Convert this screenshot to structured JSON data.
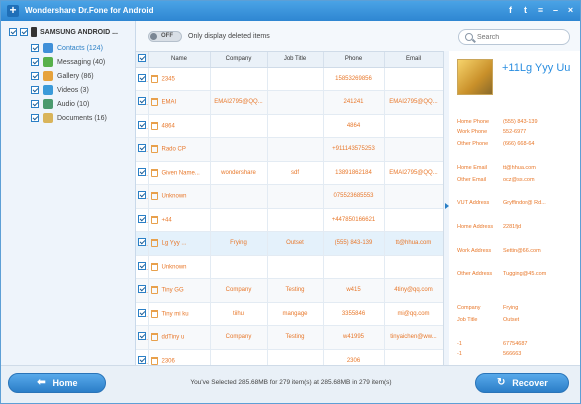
{
  "window": {
    "title": "Wondershare Dr.Fone for Android"
  },
  "titlebar_icons": [
    "facebook-icon",
    "twitter-icon",
    "menu-icon",
    "minimize-icon",
    "close-icon"
  ],
  "sidebar": {
    "device": "SAMSUNG ANDROID ...",
    "items": [
      {
        "label": "Contacts (124)",
        "icon": "contacts-icon",
        "color": "#3f8fd8",
        "active": true
      },
      {
        "label": "Messaging (40)",
        "icon": "messaging-icon",
        "color": "#57b04a",
        "active": false
      },
      {
        "label": "Gallery (86)",
        "icon": "gallery-icon",
        "color": "#e6a23c",
        "active": false
      },
      {
        "label": "Videos (3)",
        "icon": "videos-icon",
        "color": "#3a9ad9",
        "active": false
      },
      {
        "label": "Audio (10)",
        "icon": "audio-icon",
        "color": "#4b9a6e",
        "active": false
      },
      {
        "label": "Documents (16)",
        "icon": "documents-icon",
        "color": "#d9b45a",
        "active": false
      }
    ]
  },
  "toolbar": {
    "toggle_label": "OFF",
    "filter_text": "Only display deleted items",
    "search_placeholder": "Search"
  },
  "table": {
    "columns": [
      "Name",
      "Company",
      "Job Title",
      "Phone",
      "Email"
    ],
    "rows": [
      {
        "name": "2345",
        "company": "",
        "job": "",
        "phone": "15853269856",
        "email": ""
      },
      {
        "name": "EMAI",
        "company": "EMAI2795@QQ...",
        "job": "",
        "phone": "241241",
        "email": "EMAI2795@QQ..."
      },
      {
        "name": "4864",
        "company": "",
        "job": "",
        "phone": "4864",
        "email": ""
      },
      {
        "name": "Rado CP",
        "company": "",
        "job": "",
        "phone": "+911143575253",
        "email": ""
      },
      {
        "name": "Given Name...",
        "company": "wondershare",
        "job": "sdf",
        "phone": "13891862184",
        "email": "EMAI2795@QQ..."
      },
      {
        "name": "Unknown",
        "company": "",
        "job": "",
        "phone": "075523685553",
        "email": ""
      },
      {
        "name": "+44",
        "company": "",
        "job": "",
        "phone": "+447850166621",
        "email": ""
      },
      {
        "name": "Lg Yyy ...",
        "company": "Frying",
        "job": "Outset",
        "phone": "(555) 843-139",
        "email": "tt@hhua.com"
      },
      {
        "name": "Unknown",
        "company": "",
        "job": "",
        "phone": "",
        "email": ""
      },
      {
        "name": "Tiny GG",
        "company": "Company",
        "job": "Testing",
        "phone": "w415",
        "email": "4tiny@qq.com"
      },
      {
        "name": "Tiny mi ku",
        "company": "tiihu",
        "job": "mangage",
        "phone": "3355846",
        "email": "mi@qq.com"
      },
      {
        "name": "ddTiny u",
        "company": "Company",
        "job": "Testing",
        "phone": "w41995",
        "email": "tinyaichen@ww..."
      },
      {
        "name": "2306",
        "company": "",
        "job": "",
        "phone": "2306",
        "email": ""
      }
    ]
  },
  "detail": {
    "name": "+11Lg Yyy Uu",
    "fields": [
      {
        "label": "Home Phone",
        "value": "(555) 843-139"
      },
      {
        "label": "Work Phone",
        "value": "552-6977"
      },
      {
        "label": "Other Phone",
        "value": "(666) 668-64"
      },
      {
        "label": "Home Email",
        "value": "tt@hhua.com"
      },
      {
        "label": "Other Email",
        "value": "ocz@ss.com"
      },
      {
        "label": "VUT Address",
        "value": "Gryffindor@ Rd..."
      },
      {
        "label": "Home Address",
        "value": "2281fjd"
      },
      {
        "label": "Work Address",
        "value": "Settin@66.com"
      },
      {
        "label": "Other Address",
        "value": "Tugging@45.com"
      },
      {
        "label": "Company",
        "value": "Frying"
      },
      {
        "label": "Job Title",
        "value": "Outset"
      },
      {
        "label": "-1",
        "value": "67754687"
      },
      {
        "label": "-1",
        "value": "566663"
      }
    ]
  },
  "bottom": {
    "home_label": "Home",
    "recover_label": "Recover",
    "status": "You've Selected 285.68MB for 279 item(s) at 285.68MB in 279 item(s)"
  }
}
